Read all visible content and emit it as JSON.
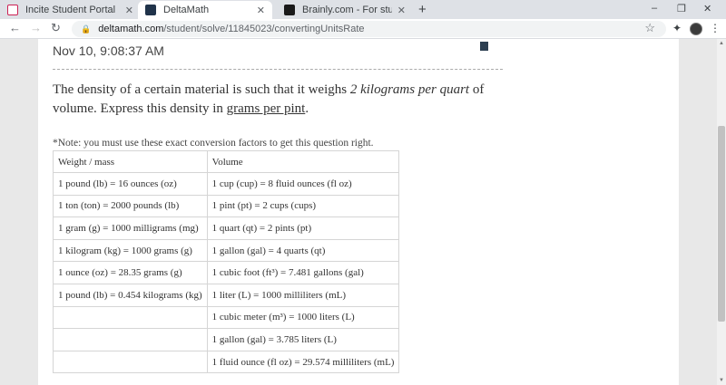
{
  "browser": {
    "tabs": [
      {
        "title": "Incite Student Portal",
        "icon": "incite-favicon"
      },
      {
        "title": "DeltaMath",
        "icon": "deltamath-favicon"
      },
      {
        "title": "Brainly.com - For students. By st",
        "icon": "brainly-favicon"
      }
    ],
    "close_glyph": "✕",
    "new_tab_glyph": "+",
    "url_host": "deltamath.com",
    "url_path": "/student/solve/11845023/convertingUnitsRate"
  },
  "page": {
    "timestamp": "Nov 10, 9:08:37 AM",
    "question": {
      "part1": "The density of a certain material is such that it weighs ",
      "emphasis": "2 kilograms per quart",
      "part2": " of volume. Express this density in ",
      "target_unit": "grams per pint",
      "part3": "."
    },
    "note": "*Note: you must use these exact conversion factors to get this question right.",
    "table": {
      "headers": [
        "Weight / mass",
        "Volume"
      ],
      "rows": [
        [
          "1 pound (lb) = 16 ounces (oz)",
          "1 cup (cup) = 8 fluid ounces (fl oz)"
        ],
        [
          "1 ton (ton) = 2000 pounds (lb)",
          "1 pint (pt) = 2 cups (cups)"
        ],
        [
          "1 gram (g) = 1000 milligrams (mg)",
          "1 quart (qt) = 2 pints (pt)"
        ],
        [
          "1 kilogram (kg) = 1000 grams (g)",
          "1 gallon (gal) = 4 quarts (qt)"
        ],
        [
          "1 ounce (oz) = 28.35 grams (g)",
          "1 cubic foot (ft³) = 7.481 gallons (gal)"
        ],
        [
          "1 pound (lb) = 0.454 kilograms (kg)",
          "1 liter (L) = 1000 milliliters (mL)"
        ],
        [
          "",
          "1 cubic meter (m³) = 1000 liters (L)"
        ],
        [
          "",
          "1 gallon (gal) = 3.785 liters (L)"
        ],
        [
          "",
          "1 fluid ounce (fl oz) = 29.574 milliliters (mL)"
        ]
      ]
    }
  }
}
